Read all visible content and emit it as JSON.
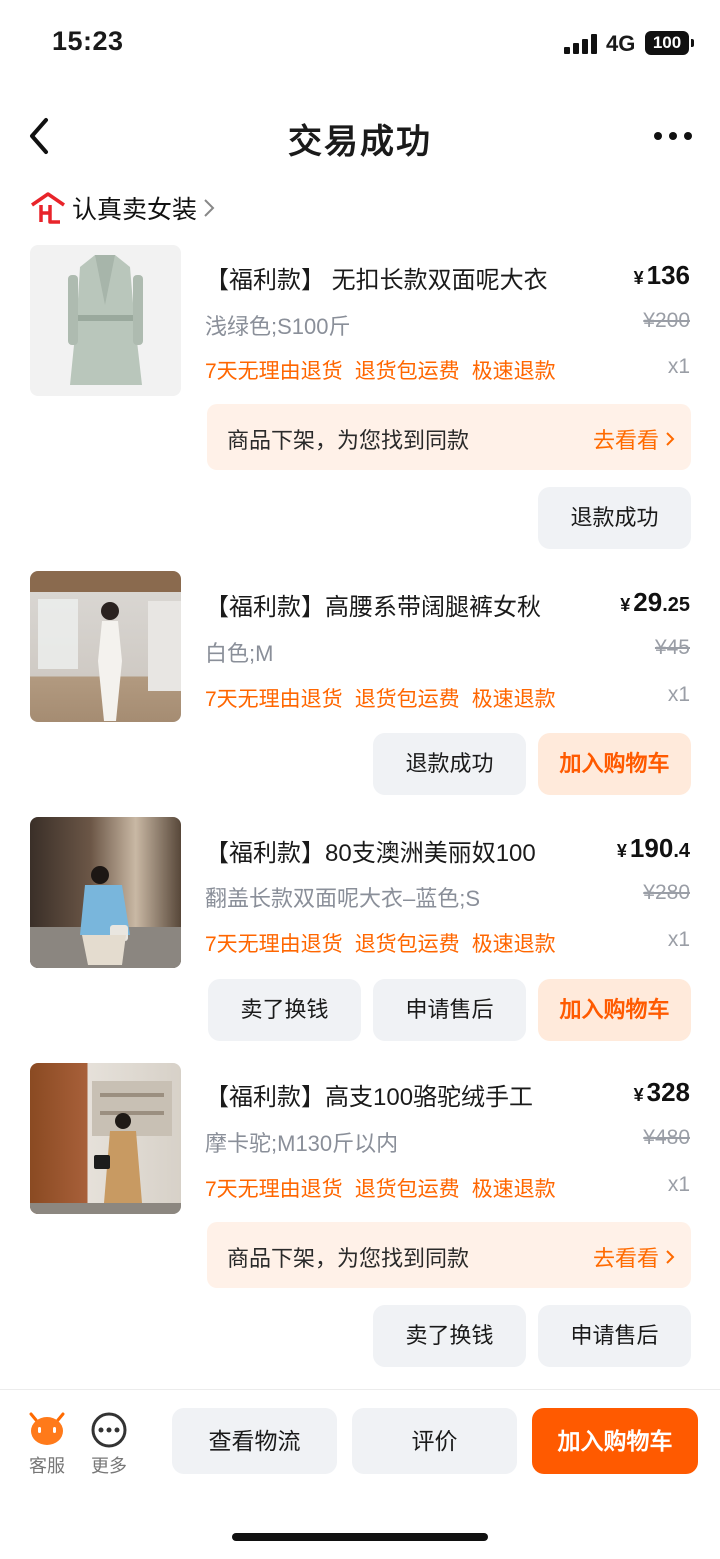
{
  "status_bar": {
    "time": "15:23",
    "network": "4G",
    "battery": "100"
  },
  "nav": {
    "title": "交易成功"
  },
  "shop": {
    "name": "认真卖女装"
  },
  "items": [
    {
      "title": "【福利款】 无扣长款双面呢大衣",
      "price_int": "136",
      "price_dec": "",
      "original_price": "¥200",
      "spec": "浅绿色;S100斤",
      "tags": [
        "7天无理由退货",
        "退货包运费",
        "极速退款"
      ],
      "quantity": "x1",
      "notice": {
        "text": "商品下架，为您找到同款",
        "link": "去看看"
      },
      "buttons": [
        "退款成功"
      ]
    },
    {
      "title": "【福利款】高腰系带阔腿裤女秋",
      "price_int": "29",
      "price_dec": ".25",
      "original_price": "¥45",
      "spec": "白色;M",
      "tags": [
        "7天无理由退货",
        "退货包运费",
        "极速退款"
      ],
      "quantity": "x1",
      "buttons": [
        "退款成功",
        "加入购物车"
      ]
    },
    {
      "title": "【福利款】80支澳洲美丽奴100",
      "price_int": "190",
      "price_dec": ".4",
      "original_price": "¥280",
      "spec": "翻盖长款双面呢大衣–蓝色;S",
      "tags": [
        "7天无理由退货",
        "退货包运费",
        "极速退款"
      ],
      "quantity": "x1",
      "buttons": [
        "卖了换钱",
        "申请售后",
        "加入购物车"
      ]
    },
    {
      "title": "【福利款】高支100骆驼绒手工",
      "price_int": "328",
      "price_dec": "",
      "original_price": "¥480",
      "spec": "摩卡驼;M130斤以内",
      "tags": [
        "7天无理由退货",
        "退货包运费",
        "极速退款"
      ],
      "quantity": "x1",
      "notice": {
        "text": "商品下架，为您找到同款",
        "link": "去看看"
      },
      "buttons": [
        "卖了换钱",
        "申请售后"
      ]
    }
  ],
  "currency": "¥",
  "bottom_bar": {
    "service_label": "客服",
    "more_label": "更多",
    "logistics_button": "查看物流",
    "review_button": "评价",
    "cart_button": "加入购物车"
  },
  "colors": {
    "accent": "#ff5a00",
    "tag": "#ff6600",
    "notice_bg": "#fff1e8",
    "button_gray": "#f0f2f5"
  }
}
